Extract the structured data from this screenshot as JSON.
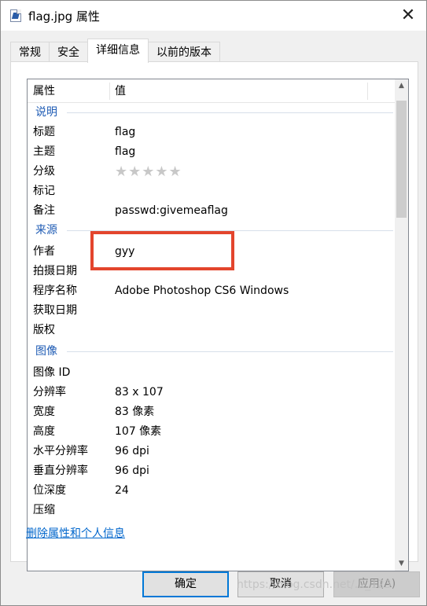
{
  "window": {
    "title": "flag.jpg 属性",
    "close_glyph": "✕"
  },
  "tabs": [
    {
      "label": "常规"
    },
    {
      "label": "安全"
    },
    {
      "label": "详细信息"
    },
    {
      "label": "以前的版本"
    }
  ],
  "active_tab": "详细信息",
  "list": {
    "header": {
      "property": "属性",
      "value": "值"
    },
    "groups": {
      "description": "说明",
      "origin": "来源",
      "image": "图像"
    },
    "rows": {
      "title": {
        "name": "标题",
        "value": "flag"
      },
      "subject": {
        "name": "主题",
        "value": "flag"
      },
      "rating": {
        "name": "分级",
        "value": "★★★★★"
      },
      "tags": {
        "name": "标记",
        "value": ""
      },
      "comments": {
        "name": "备注",
        "value": "passwd:givemeaflag"
      },
      "author": {
        "name": "作者",
        "value": "gyy"
      },
      "date_taken": {
        "name": "拍摄日期",
        "value": ""
      },
      "program": {
        "name": "程序名称",
        "value": "Adobe Photoshop CS6 Windows"
      },
      "date_acquired": {
        "name": "获取日期",
        "value": ""
      },
      "copyright": {
        "name": "版权",
        "value": ""
      },
      "image_id": {
        "name": "图像 ID",
        "value": ""
      },
      "dimensions": {
        "name": "分辨率",
        "value": "83 x 107"
      },
      "width": {
        "name": "宽度",
        "value": "83 像素"
      },
      "height": {
        "name": "高度",
        "value": "107 像素"
      },
      "h_res": {
        "name": "水平分辨率",
        "value": "96 dpi"
      },
      "v_res": {
        "name": "垂直分辨率",
        "value": "96 dpi"
      },
      "bit_depth": {
        "name": "位深度",
        "value": "24"
      },
      "compression": {
        "name": "压缩",
        "value": ""
      }
    },
    "scroll_up_glyph": "▲",
    "scroll_down_glyph": "▼"
  },
  "remove_link": "删除属性和个人信息",
  "buttons": {
    "ok": "确定",
    "cancel": "取消",
    "apply": "应用(A)"
  },
  "watermark": "https://blog.csdn.net/..._123",
  "colors": {
    "highlight": "#e3452d",
    "group": "#1e5bb4",
    "link": "#0066cc",
    "ok_border": "#0078d7"
  }
}
